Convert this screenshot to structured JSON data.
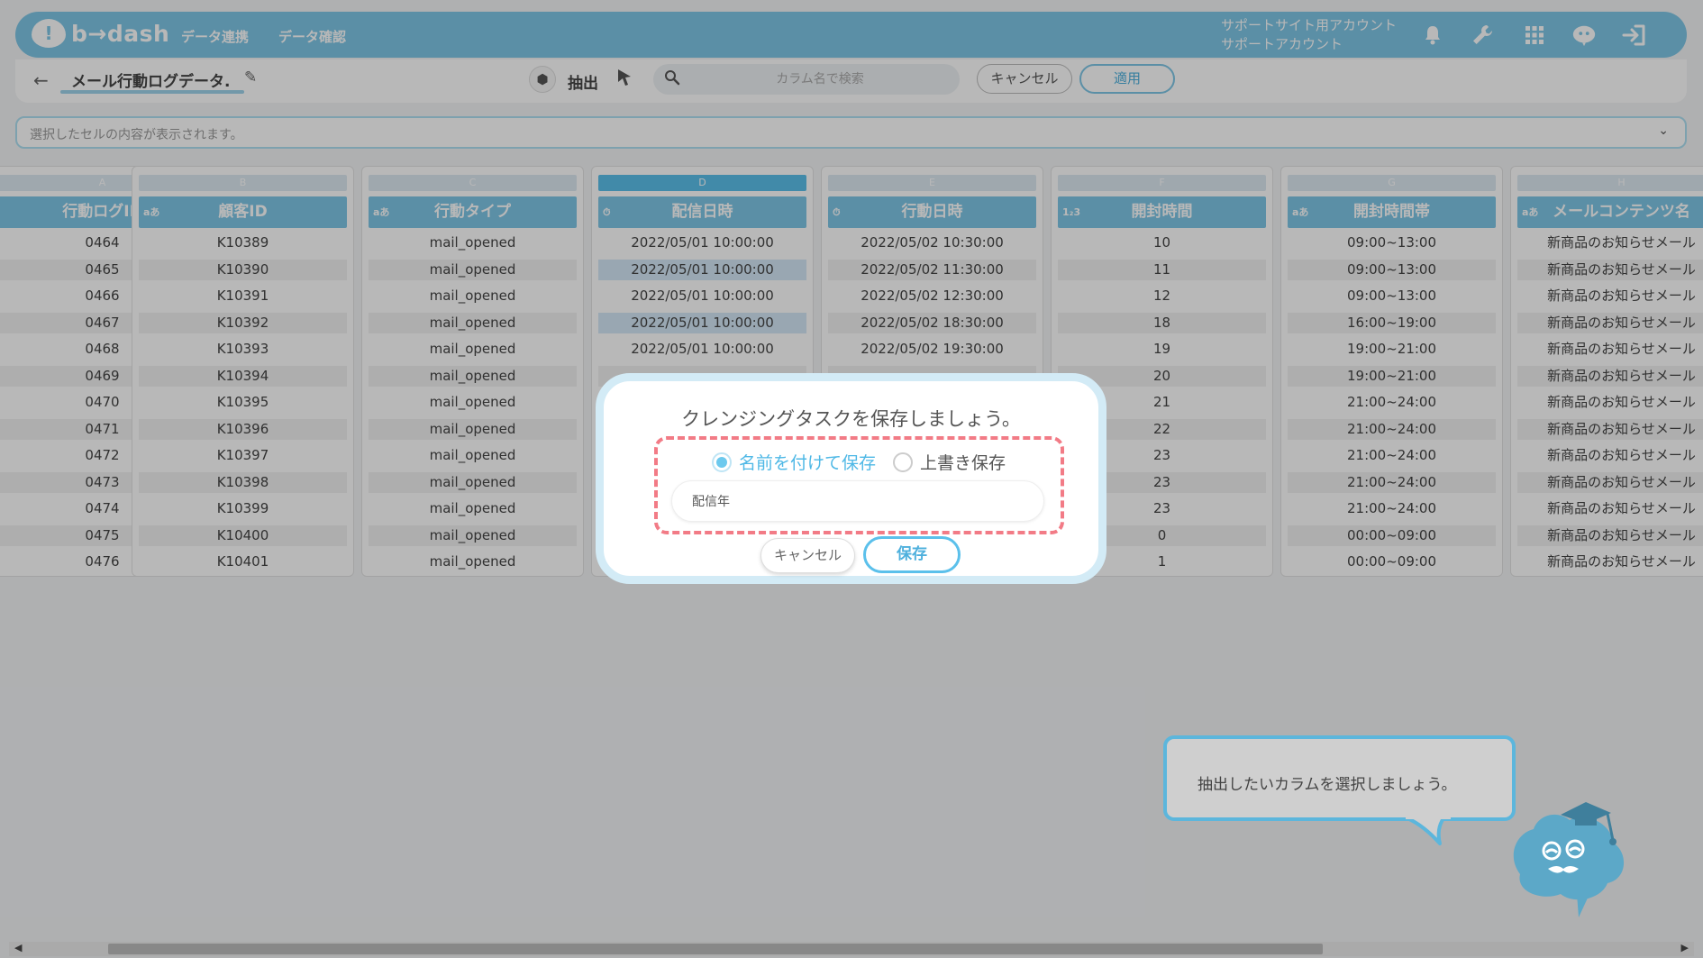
{
  "header": {
    "logo_mark": "!",
    "logo_text": "b→dash",
    "nav": [
      "データ連携",
      "データ確認"
    ],
    "account_line1": "サポートサイト用アカウント",
    "account_line2": "サポートアカウント",
    "icons": [
      "bell-icon",
      "wrench-icon",
      "apps-grid-icon",
      "mascot-head-icon",
      "logout-icon"
    ]
  },
  "toolbar": {
    "back_glyph": "←",
    "dataset_name": "メール行動ログデータ.",
    "extract_label": "抽出",
    "search_placeholder": "カラム名で検索",
    "cancel_label": "キャンセル",
    "apply_label": "適用"
  },
  "cellbar": {
    "placeholder": "選択したセルの内容が表示されます。"
  },
  "columns": [
    {
      "letter": "A",
      "type": "",
      "name": "行動ログID",
      "cells": [
        "0464",
        "0465",
        "0466",
        "0467",
        "0468",
        "0469",
        "0470",
        "0471",
        "0472",
        "0473",
        "0474",
        "0475",
        "0476"
      ]
    },
    {
      "letter": "B",
      "type": "aあ",
      "name": "顧客ID",
      "cells": [
        "K10389",
        "K10390",
        "K10391",
        "K10392",
        "K10393",
        "K10394",
        "K10395",
        "K10396",
        "K10397",
        "K10398",
        "K10399",
        "K10400",
        "K10401"
      ]
    },
    {
      "letter": "C",
      "type": "aあ",
      "name": "行動タイプ",
      "cells": [
        "mail_opened",
        "mail_opened",
        "mail_opened",
        "mail_opened",
        "mail_opened",
        "mail_opened",
        "mail_opened",
        "mail_opened",
        "mail_opened",
        "mail_opened",
        "mail_opened",
        "mail_opened",
        "mail_opened"
      ]
    },
    {
      "letter": "D",
      "type": "⏱",
      "name": "配信日時",
      "cells": [
        "2022/05/01 10:00:00",
        "2022/05/01 10:00:00",
        "2022/05/01 10:00:00",
        "2022/05/01 10:00:00",
        "2022/05/01 10:00:00",
        "",
        "",
        "",
        "",
        "",
        "",
        "",
        ""
      ]
    },
    {
      "letter": "E",
      "type": "⏱",
      "name": "行動日時",
      "cells": [
        "2022/05/02 10:30:00",
        "2022/05/02 11:30:00",
        "2022/05/02 12:30:00",
        "2022/05/02 18:30:00",
        "2022/05/02 19:30:00",
        "",
        "",
        "",
        "",
        "",
        "",
        "",
        ""
      ]
    },
    {
      "letter": "F",
      "type": "1₂3",
      "name": "開封時間",
      "cells": [
        "10",
        "11",
        "12",
        "18",
        "19",
        "20",
        "21",
        "22",
        "23",
        "23",
        "23",
        "0",
        "1"
      ]
    },
    {
      "letter": "G",
      "type": "aあ",
      "name": "開封時間帯",
      "cells": [
        "09:00~13:00",
        "09:00~13:00",
        "09:00~13:00",
        "16:00~19:00",
        "19:00~21:00",
        "19:00~21:00",
        "21:00~24:00",
        "21:00~24:00",
        "21:00~24:00",
        "21:00~24:00",
        "21:00~24:00",
        "00:00~09:00",
        "00:00~09:00"
      ]
    },
    {
      "letter": "H",
      "type": "aあ",
      "name": "メールコンテンツ名",
      "cells": [
        "新商品のお知らせメール",
        "新商品のお知らせメール",
        "新商品のお知らせメール",
        "新商品のお知らせメール",
        "新商品のお知らせメール",
        "新商品のお知らせメール",
        "新商品のお知らせメール",
        "新商品のお知らせメール",
        "新商品のお知らせメール",
        "新商品のお知らせメール",
        "新商品のお知らせメール",
        "新商品のお知らせメール",
        "新商品のお知らせメール"
      ]
    }
  ],
  "modal": {
    "title": "クレンジングタスクを保存しましょう。",
    "option_new": "名前を付けて保存",
    "option_overwrite": "上書き保存",
    "selected_option": "名前を付けて保存",
    "name_value": "配信年",
    "cancel_label": "キャンセル",
    "save_label": "保存"
  },
  "tooltip": {
    "text": "抽出したいカラムを選択しましょう。"
  },
  "colors": {
    "accent": "#7ec6e6",
    "highlight_dash": "#f27b86"
  }
}
